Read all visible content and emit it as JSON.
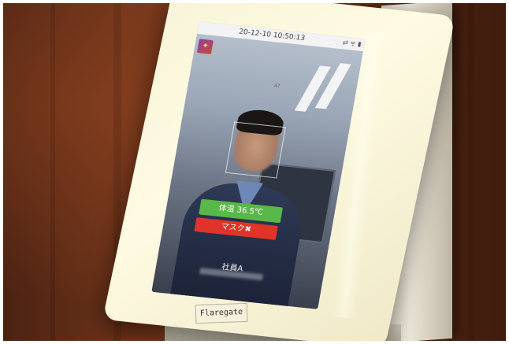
{
  "screen": {
    "status_time": "20-12-10 10:50:13",
    "status_icons": "⇄ ᯤ ▮",
    "logo_glyph": "✦",
    "ceiling_label": "47",
    "temperature_label": "体温 36.5℃",
    "mask_label": "マスク✖",
    "name_label": "社員A"
  },
  "device": {
    "brand": "Flaregate"
  },
  "colors": {
    "temperature_ok": "#58b848",
    "mask_alert": "#e0342a",
    "wall": "#6e3419",
    "frame": "#fffbe3"
  }
}
